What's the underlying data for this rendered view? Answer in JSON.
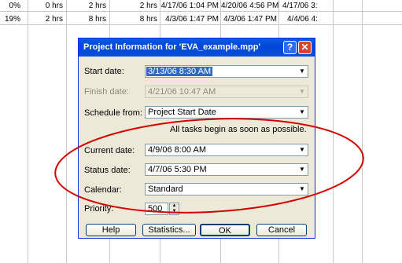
{
  "background_rows": [
    [
      "0%",
      "0 hrs",
      "2 hrs",
      "2 hrs",
      "4/17/06 1:04 PM",
      "4/20/06 4:56 PM",
      "4/17/06 3:"
    ],
    [
      "19%",
      "2 hrs",
      "8 hrs",
      "8 hrs",
      "4/3/06 1:47 PM",
      "4/3/06 1:47 PM",
      "4/4/06 4:"
    ]
  ],
  "dialog": {
    "title": "Project Information for 'EVA_example.mpp'",
    "help_glyph": "?",
    "close_glyph": "✕",
    "start_date_label": "Start date:",
    "start_date_value": "3/13/06 8:30 AM",
    "finish_date_label": "Finish date:",
    "finish_date_value": "4/21/06 10:47 AM",
    "schedule_from_label": "Schedule from:",
    "schedule_from_value": "Project Start Date",
    "schedule_note": "All tasks begin as soon as possible.",
    "current_date_label": "Current date:",
    "current_date_value": "4/9/06 8:00 AM",
    "status_date_label": "Status date:",
    "status_date_value": "4/7/06 5:30 PM",
    "calendar_label": "Calendar:",
    "calendar_value": "Standard",
    "priority_label": "Priority:",
    "priority_value": "500",
    "help_button": "Help",
    "statistics_button": "Statistics...",
    "ok_button": "OK",
    "cancel_button": "Cancel"
  },
  "annotation_color": "#d40000"
}
